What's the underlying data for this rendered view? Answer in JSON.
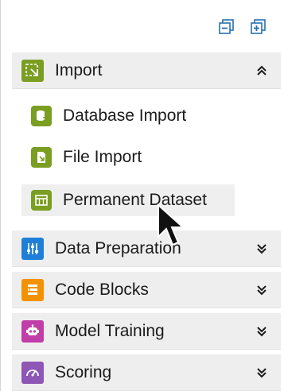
{
  "toolbar": {
    "collapse_all_icon": "collapse-all-icon",
    "expand_all_icon": "expand-all-icon"
  },
  "sections": [
    {
      "label": "Import",
      "expanded": true,
      "color": "#7a9e22",
      "icon": "import-icon"
    },
    {
      "label": "Data Preparation",
      "expanded": false,
      "color": "#1f7fd8",
      "icon": "sliders-icon"
    },
    {
      "label": "Code Blocks",
      "expanded": false,
      "color": "#f39200",
      "icon": "code-blocks-icon"
    },
    {
      "label": "Model Training",
      "expanded": false,
      "color": "#c13ea8",
      "icon": "robot-icon"
    },
    {
      "label": "Scoring",
      "expanded": false,
      "color": "#8e56b5",
      "icon": "gauge-icon"
    }
  ],
  "import_items": [
    {
      "label": "Database Import",
      "icon": "database-import-icon"
    },
    {
      "label": "File Import",
      "icon": "file-import-icon"
    },
    {
      "label": "Permanent Dataset",
      "icon": "table-icon"
    }
  ],
  "colors": {
    "header_bg": "#eeeeee",
    "toolbar_icon": "#2a6fb0",
    "green": "#7a9e22"
  }
}
